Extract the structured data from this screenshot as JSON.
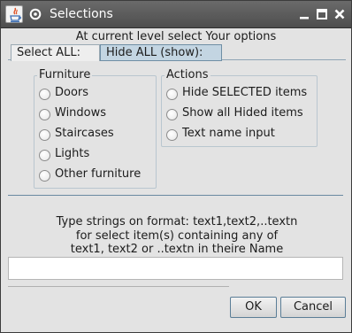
{
  "window": {
    "title": "Selections",
    "icons": [
      "java-icon",
      "window-menu-icon",
      "minimize-icon",
      "maximize-icon",
      "close-icon"
    ]
  },
  "heading": "At current level select Your options",
  "tabs": [
    {
      "label": "Select ALL:",
      "selected": false
    },
    {
      "label": "Hide ALL (show):",
      "selected": true
    }
  ],
  "furniture": {
    "title": "Furniture",
    "options": [
      "Doors",
      "Windows",
      "Staircases",
      "Lights",
      "Other furniture"
    ]
  },
  "actions": {
    "title": "Actions",
    "options": [
      "Hide SELECTED items",
      "Show all Hided items",
      "Text name input"
    ]
  },
  "instructions": [
    "Type strings on format: text1,text2,..textn",
    "for select item(s) containing any of",
    "text1, text2 or ..textn in theire Name"
  ],
  "text_input": {
    "value": ""
  },
  "buttons": {
    "ok": "OK",
    "cancel": "Cancel"
  }
}
